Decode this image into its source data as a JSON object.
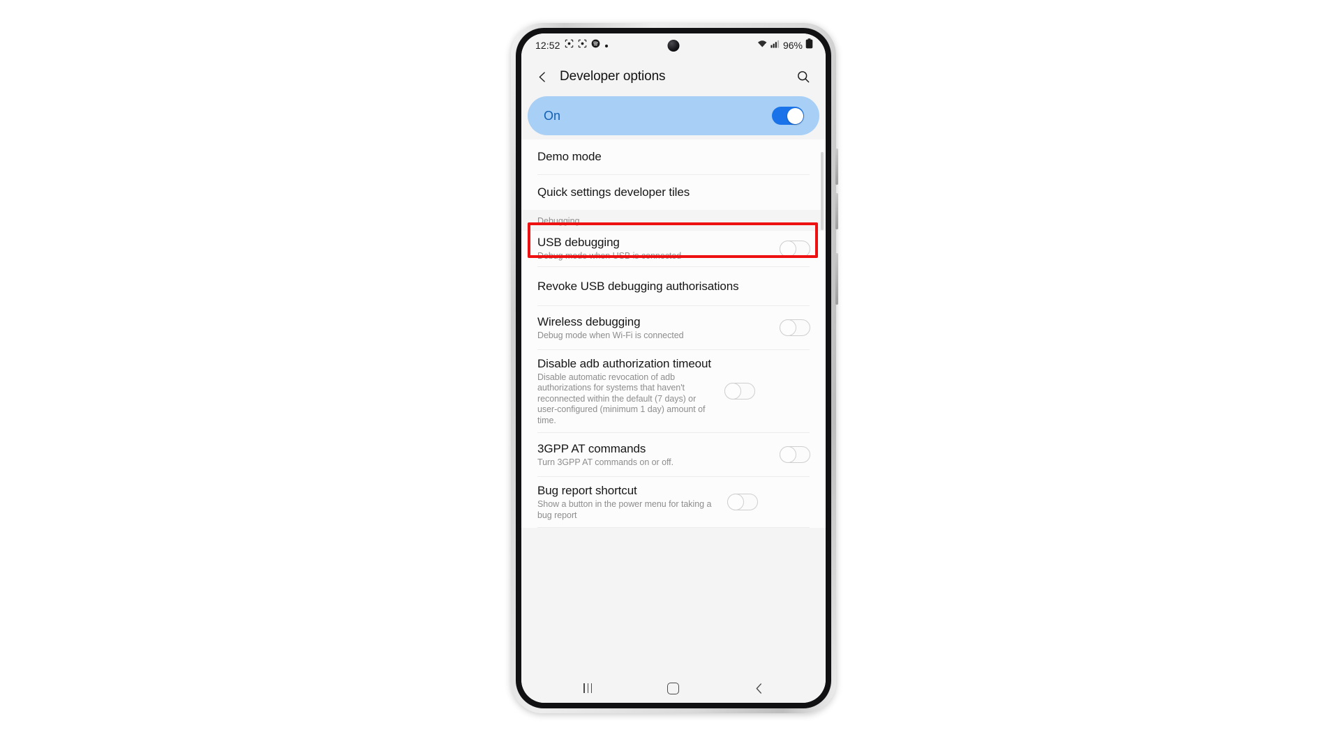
{
  "status_bar": {
    "time": "12:52",
    "left_icons": [
      "scan-frame-icon",
      "scan-frame-icon",
      "spotify-icon",
      "dot-icon"
    ],
    "wifi_icon": "wifi-icon",
    "signal_icon": "cellular-signal-icon",
    "battery_percent": "96%",
    "battery_icon": "battery-full-icon"
  },
  "header": {
    "back_icon": "back-chevron-icon",
    "title": "Developer options",
    "search_icon": "search-icon"
  },
  "master_switch": {
    "label": "On",
    "state": "on",
    "accent_color": "#1a73e8",
    "banner_color": "#a8cff5",
    "label_color": "#1260b4"
  },
  "list": {
    "group_one": [
      {
        "title": "Demo mode",
        "subtitle": "",
        "control": "none"
      },
      {
        "title": "Quick settings developer tiles",
        "subtitle": "",
        "control": "none"
      }
    ],
    "section_title": "Debugging",
    "group_two": [
      {
        "title": "USB debugging",
        "subtitle": "Debug mode when USB is connected",
        "control": "toggle-off",
        "highlighted": true
      },
      {
        "title": "Revoke USB debugging authorisations",
        "subtitle": "",
        "control": "none",
        "highlighted": false
      },
      {
        "title": "Wireless debugging",
        "subtitle": "Debug mode when Wi-Fi is connected",
        "control": "toggle-off",
        "highlighted": false
      },
      {
        "title": "Disable adb authorization timeout",
        "subtitle": "Disable automatic revocation of adb authorizations for systems that haven't reconnected within the default (7 days) or user-configured (minimum 1 day) amount of time.",
        "control": "toggle-off",
        "highlighted": false
      },
      {
        "title": "3GPP AT commands",
        "subtitle": "Turn 3GPP AT commands on or off.",
        "control": "toggle-off",
        "highlighted": false
      },
      {
        "title": "Bug report shortcut",
        "subtitle": "Show a button in the power menu for taking a bug report",
        "control": "toggle-off",
        "highlighted": false
      }
    ]
  },
  "annotation": {
    "color": "#ee1111",
    "target": "USB debugging"
  },
  "nav_bar": {
    "recents_icon": "recents-icon",
    "home_icon": "home-icon",
    "back_icon": "back-icon"
  }
}
